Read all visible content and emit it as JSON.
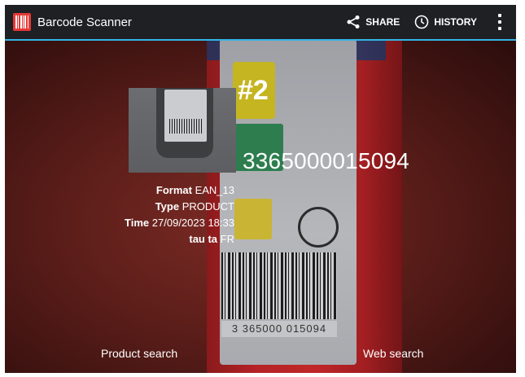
{
  "app": {
    "title": "Barcode Scanner"
  },
  "actions": {
    "share": "SHARE",
    "history": "HISTORY"
  },
  "camera": {
    "barcode_digits": "3 365000 015094",
    "sticker_text": "#2"
  },
  "result": {
    "code": "3365000015094",
    "format_label": "Format",
    "format_value": "EAN_13",
    "type_label": "Type",
    "type_value": "PRODUCT",
    "time_label": "Time",
    "time_value": "27/09/2023 18:33",
    "meta_label": "tau ta",
    "meta_value": "FR"
  },
  "buttons": {
    "product_search": "Product search",
    "web_search": "Web search"
  },
  "colors": {
    "accent": "#33b5e5",
    "actionbar": "#1f2024",
    "app_icon": "#e53935"
  },
  "icons": {
    "app": "barcode-icon",
    "share": "share-icon",
    "history": "clock-icon",
    "overflow": "overflow-menu-icon"
  }
}
